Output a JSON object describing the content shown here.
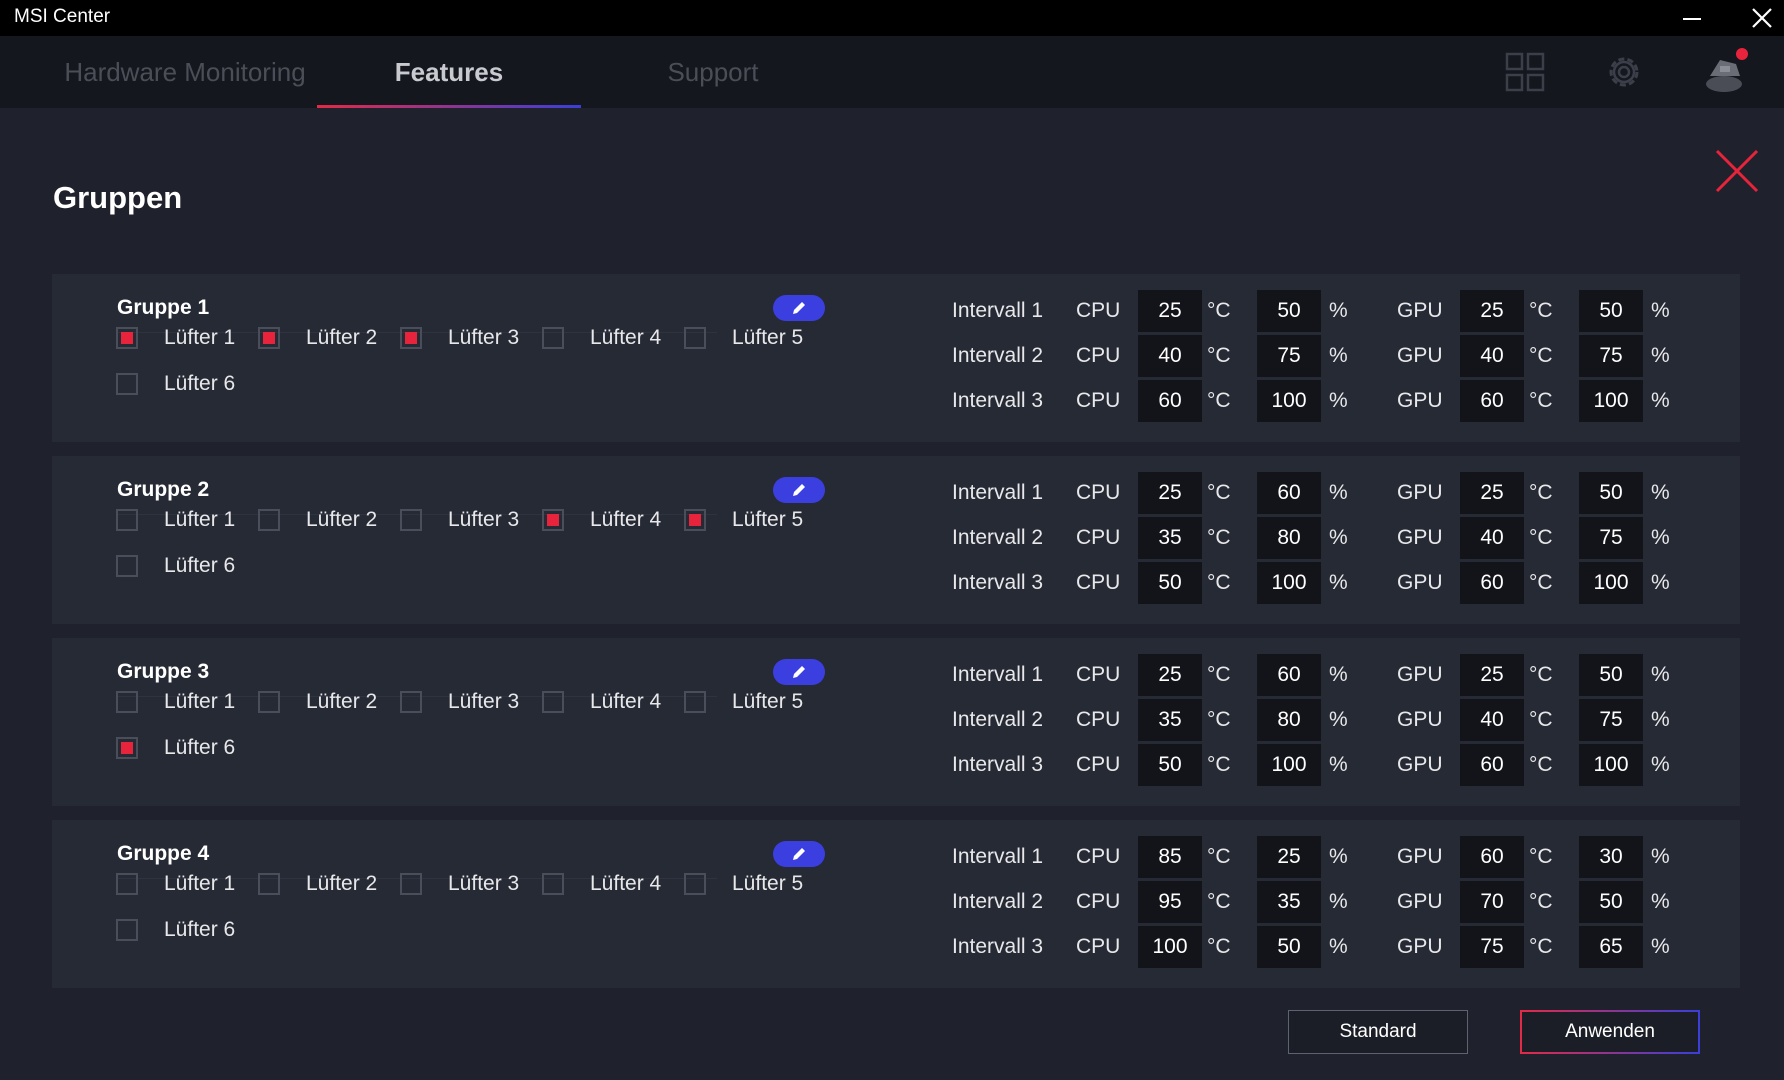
{
  "window": {
    "title": "MSI Center"
  },
  "tabs": [
    {
      "label": "Hardware Monitoring",
      "active": false
    },
    {
      "label": "Features",
      "active": true
    },
    {
      "label": "Support",
      "active": false
    }
  ],
  "nav_icons": [
    "grid-icon",
    "gear-icon",
    "avatar-icon"
  ],
  "page": {
    "heading": "Gruppen"
  },
  "labels": {
    "cpu": "CPU",
    "gpu": "GPU",
    "celsius": "°C",
    "percent": "%"
  },
  "groups": [
    {
      "name": "Gruppe 1",
      "fans": [
        {
          "label": "Lüfter 1",
          "checked": true
        },
        {
          "label": "Lüfter 2",
          "checked": true
        },
        {
          "label": "Lüfter 3",
          "checked": true
        },
        {
          "label": "Lüfter 4",
          "checked": false
        },
        {
          "label": "Lüfter 5",
          "checked": false
        },
        {
          "label": "Lüfter 6",
          "checked": false
        }
      ],
      "intervals": [
        {
          "label": "Intervall 1",
          "cpu_temp": "25",
          "cpu_pct": "50",
          "gpu_temp": "25",
          "gpu_pct": "50"
        },
        {
          "label": "Intervall 2",
          "cpu_temp": "40",
          "cpu_pct": "75",
          "gpu_temp": "40",
          "gpu_pct": "75"
        },
        {
          "label": "Intervall 3",
          "cpu_temp": "60",
          "cpu_pct": "100",
          "gpu_temp": "60",
          "gpu_pct": "100"
        }
      ]
    },
    {
      "name": "Gruppe 2",
      "fans": [
        {
          "label": "Lüfter 1",
          "checked": false
        },
        {
          "label": "Lüfter 2",
          "checked": false
        },
        {
          "label": "Lüfter 3",
          "checked": false
        },
        {
          "label": "Lüfter 4",
          "checked": true
        },
        {
          "label": "Lüfter 5",
          "checked": true
        },
        {
          "label": "Lüfter 6",
          "checked": false
        }
      ],
      "intervals": [
        {
          "label": "Intervall 1",
          "cpu_temp": "25",
          "cpu_pct": "60",
          "gpu_temp": "25",
          "gpu_pct": "50"
        },
        {
          "label": "Intervall 2",
          "cpu_temp": "35",
          "cpu_pct": "80",
          "gpu_temp": "40",
          "gpu_pct": "75"
        },
        {
          "label": "Intervall 3",
          "cpu_temp": "50",
          "cpu_pct": "100",
          "gpu_temp": "60",
          "gpu_pct": "100"
        }
      ]
    },
    {
      "name": "Gruppe 3",
      "fans": [
        {
          "label": "Lüfter 1",
          "checked": false
        },
        {
          "label": "Lüfter 2",
          "checked": false
        },
        {
          "label": "Lüfter 3",
          "checked": false
        },
        {
          "label": "Lüfter 4",
          "checked": false
        },
        {
          "label": "Lüfter 5",
          "checked": false
        },
        {
          "label": "Lüfter 6",
          "checked": true
        }
      ],
      "intervals": [
        {
          "label": "Intervall 1",
          "cpu_temp": "25",
          "cpu_pct": "60",
          "gpu_temp": "25",
          "gpu_pct": "50"
        },
        {
          "label": "Intervall 2",
          "cpu_temp": "35",
          "cpu_pct": "80",
          "gpu_temp": "40",
          "gpu_pct": "75"
        },
        {
          "label": "Intervall 3",
          "cpu_temp": "50",
          "cpu_pct": "100",
          "gpu_temp": "60",
          "gpu_pct": "100"
        }
      ]
    },
    {
      "name": "Gruppe 4",
      "fans": [
        {
          "label": "Lüfter 1",
          "checked": false
        },
        {
          "label": "Lüfter 2",
          "checked": false
        },
        {
          "label": "Lüfter 3",
          "checked": false
        },
        {
          "label": "Lüfter 4",
          "checked": false
        },
        {
          "label": "Lüfter 5",
          "checked": false
        },
        {
          "label": "Lüfter 6",
          "checked": false
        }
      ],
      "intervals": [
        {
          "label": "Intervall 1",
          "cpu_temp": "85",
          "cpu_pct": "25",
          "gpu_temp": "60",
          "gpu_pct": "30"
        },
        {
          "label": "Intervall 2",
          "cpu_temp": "95",
          "cpu_pct": "35",
          "gpu_temp": "70",
          "gpu_pct": "50"
        },
        {
          "label": "Intervall 3",
          "cpu_temp": "100",
          "cpu_pct": "50",
          "gpu_temp": "75",
          "gpu_pct": "65"
        }
      ]
    }
  ],
  "buttons": {
    "standard": "Standard",
    "apply": "Anwenden"
  },
  "colors": {
    "accent_red": "#e8233c",
    "accent_blue": "#3b3fe0",
    "background": "#1f222c",
    "panel": "#262a35"
  }
}
